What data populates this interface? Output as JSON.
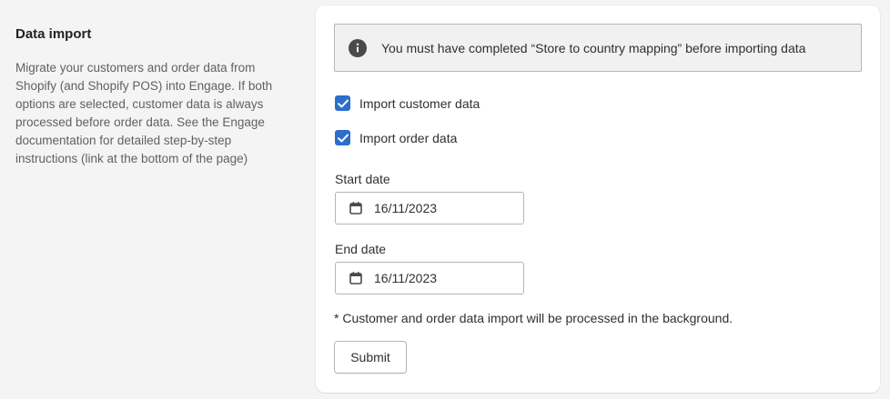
{
  "section": {
    "title": "Data import",
    "description": "Migrate your customers and order data from Shopify (and Shopify POS) into Engage. If both options are selected, customer data is always processed before order data. See the Engage documentation for detailed step-by-step instructions (link at the bottom of the page)"
  },
  "banner": {
    "icon": "info-icon",
    "text": "You must have completed “Store to country mapping” before importing data"
  },
  "options": {
    "import_customer": {
      "label": "Import customer data",
      "checked": true
    },
    "import_order": {
      "label": "Import order data",
      "checked": true
    }
  },
  "start_date": {
    "label": "Start date",
    "icon": "calendar-icon",
    "value": "16/11/2023"
  },
  "end_date": {
    "label": "End date",
    "icon": "calendar-icon",
    "value": "16/11/2023"
  },
  "footnote": "* Customer and order data import will be processed in the background.",
  "submit": {
    "label": "Submit"
  },
  "colors": {
    "checkbox": "#2c6ecb",
    "page_background": "#f4f4f4",
    "card_background": "#ffffff"
  }
}
